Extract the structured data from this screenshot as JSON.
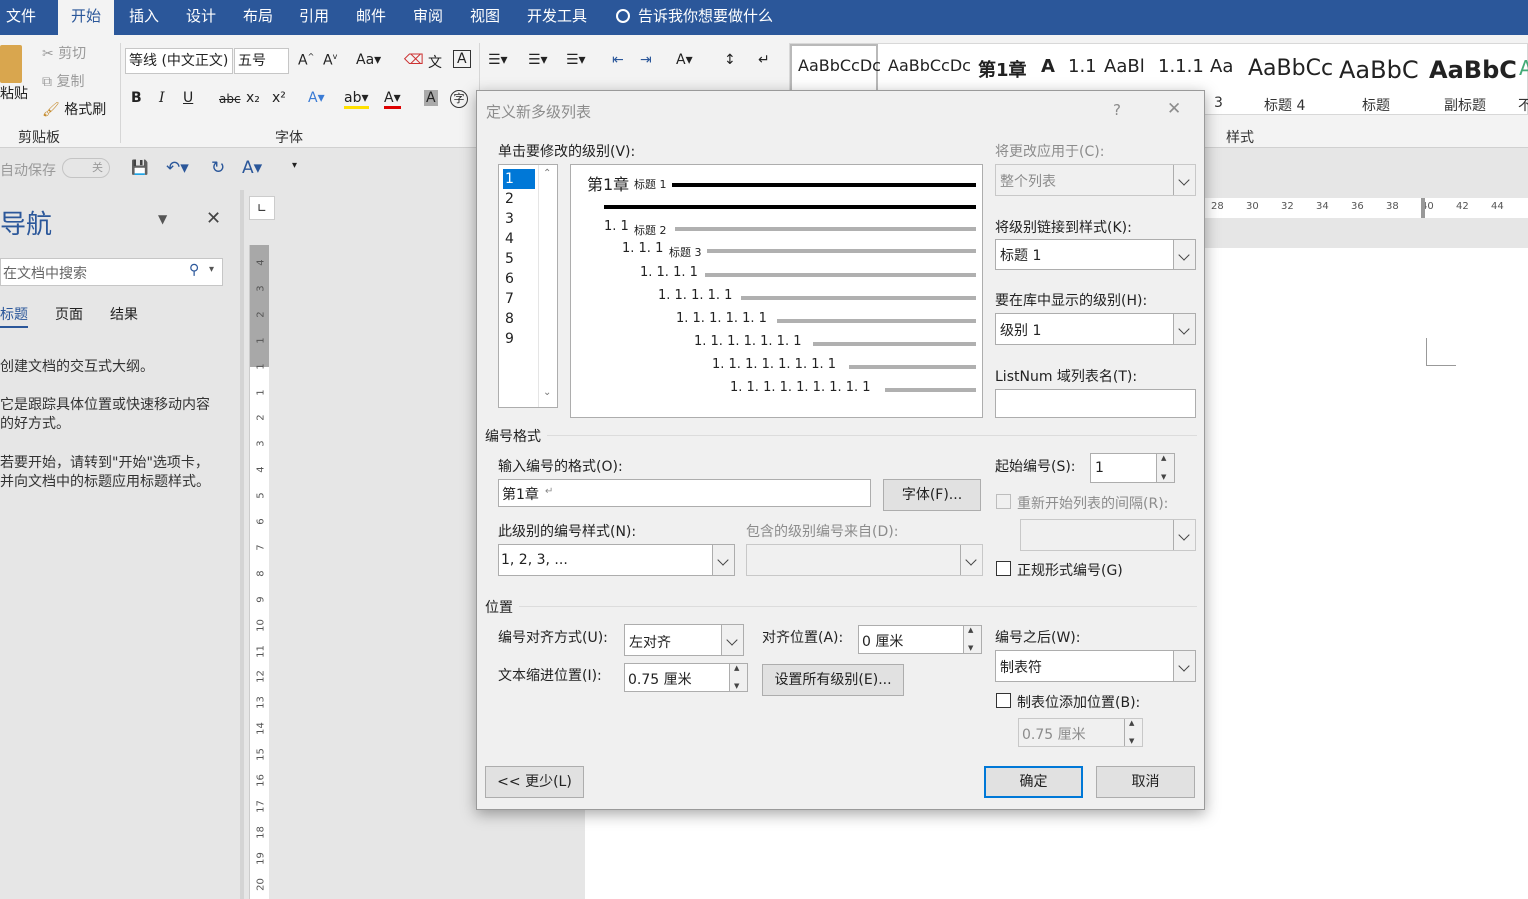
{
  "menu": {
    "items": [
      "文件",
      "开始",
      "插入",
      "设计",
      "布局",
      "引用",
      "邮件",
      "审阅",
      "视图",
      "开发工具"
    ],
    "tell_me": "告诉我你想要做什么"
  },
  "ribbon": {
    "clipboard": {
      "paste": "粘贴",
      "cut": "剪切",
      "copy": "复制",
      "format_painter": "格式刷",
      "group": "剪贴板"
    },
    "font": {
      "font_name": "等线 (中文正文)",
      "font_size": "五号",
      "group": "字体",
      "bold": "B",
      "italic": "I",
      "underline": "U",
      "strike": "abc",
      "sub": "x₂",
      "sup": "x²"
    },
    "styles": {
      "group": "样式",
      "items": [
        {
          "preview": "AaBbCcDc",
          "name": ""
        },
        {
          "preview": "AaBbCcDc",
          "name": ""
        },
        {
          "preview": "第1章",
          "name": ""
        },
        {
          "preview": "A",
          "name": ""
        },
        {
          "preview": "1.1",
          "name": ""
        },
        {
          "preview": "AaBl",
          "name": ""
        },
        {
          "preview": "1.1.1",
          "name": ""
        },
        {
          "preview": "Aa",
          "name": "3"
        },
        {
          "preview": "AaBbCc",
          "name": "标题 4"
        },
        {
          "preview": "AaBbC",
          "name": "标题"
        },
        {
          "preview": "AaBbC",
          "name": "副标题"
        },
        {
          "preview": "A",
          "name": "不"
        }
      ]
    }
  },
  "qat": {
    "autosave": "自动保存",
    "toggle": "关"
  },
  "nav": {
    "title": "导航",
    "search_placeholder": "在文档中搜索",
    "tabs": [
      "标题",
      "页面",
      "结果"
    ],
    "hint1": "创建文档的交互式大纲。",
    "hint2a": "它是跟踪具体位置或快速移动内容",
    "hint2b": "的好方式。",
    "hint3a": "若要开始，请转到\"开始\"选项卡，",
    "hint3b": "并向文档中的标题应用标题样式。"
  },
  "ruler": {
    "v_ticks": [
      "4",
      "3",
      "2",
      "1",
      "1",
      "1",
      "2",
      "3",
      "4",
      "5",
      "6",
      "7",
      "8",
      "9",
      "10",
      "11",
      "12",
      "13",
      "14",
      "15",
      "16",
      "17",
      "18",
      "19",
      "20"
    ],
    "h_ticks": [
      "28",
      "30",
      "32",
      "34",
      "36",
      "38",
      "40",
      "42",
      "44"
    ]
  },
  "dialog": {
    "title": "定义新多级列表",
    "help": "?",
    "close": "✕",
    "level_label": "单击要修改的级别(V):",
    "levels": [
      "1",
      "2",
      "3",
      "4",
      "5",
      "6",
      "7",
      "8",
      "9"
    ],
    "selected_level": "1",
    "preview": {
      "lines": [
        "第1章",
        "1. 1",
        "1. 1. 1",
        "1. 1. 1. 1",
        "1. 1. 1. 1. 1",
        "1. 1. 1. 1. 1. 1",
        "1. 1. 1. 1. 1. 1. 1",
        "1. 1. 1. 1. 1. 1. 1. 1",
        "1. 1. 1. 1. 1. 1. 1. 1. 1"
      ],
      "tags": [
        "标题 1",
        "标题 2",
        "标题 3"
      ]
    },
    "apply_to_label": "将更改应用于(C):",
    "apply_to_value": "整个列表",
    "link_style_label": "将级别链接到样式(K):",
    "link_style_value": "标题 1",
    "gallery_level_label": "要在库中显示的级别(H):",
    "gallery_level_value": "级别 1",
    "listnum_label": "ListNum 域列表名(T):",
    "listnum_value": "",
    "number_format_section": "编号格式",
    "enter_format_label": "输入编号的格式(O):",
    "enter_format_value": "第1章",
    "font_button": "字体(F)...",
    "start_at_label": "起始编号(S):",
    "start_at_value": "1",
    "restart_label": "重新开始列表的间隔(R):",
    "number_style_label": "此级别的编号样式(N):",
    "number_style_value": "1, 2, 3, ...",
    "include_from_label": "包含的级别编号来自(D):",
    "legal_label": "正规形式编号(G)",
    "position_section": "位置",
    "alignment_label": "编号对齐方式(U):",
    "alignment_value": "左对齐",
    "aligned_at_label": "对齐位置(A):",
    "aligned_at_value": "0 厘米",
    "follow_label": "编号之后(W):",
    "follow_value": "制表符",
    "indent_label": "文本缩进位置(I):",
    "indent_value": "0.75 厘米",
    "set_all_button": "设置所有级别(E)...",
    "tab_stop_label": "制表位添加位置(B):",
    "tab_stop_value": "0.75 厘米",
    "less_button": "<< 更少(L)",
    "ok_button": "确定",
    "cancel_button": "取消"
  }
}
